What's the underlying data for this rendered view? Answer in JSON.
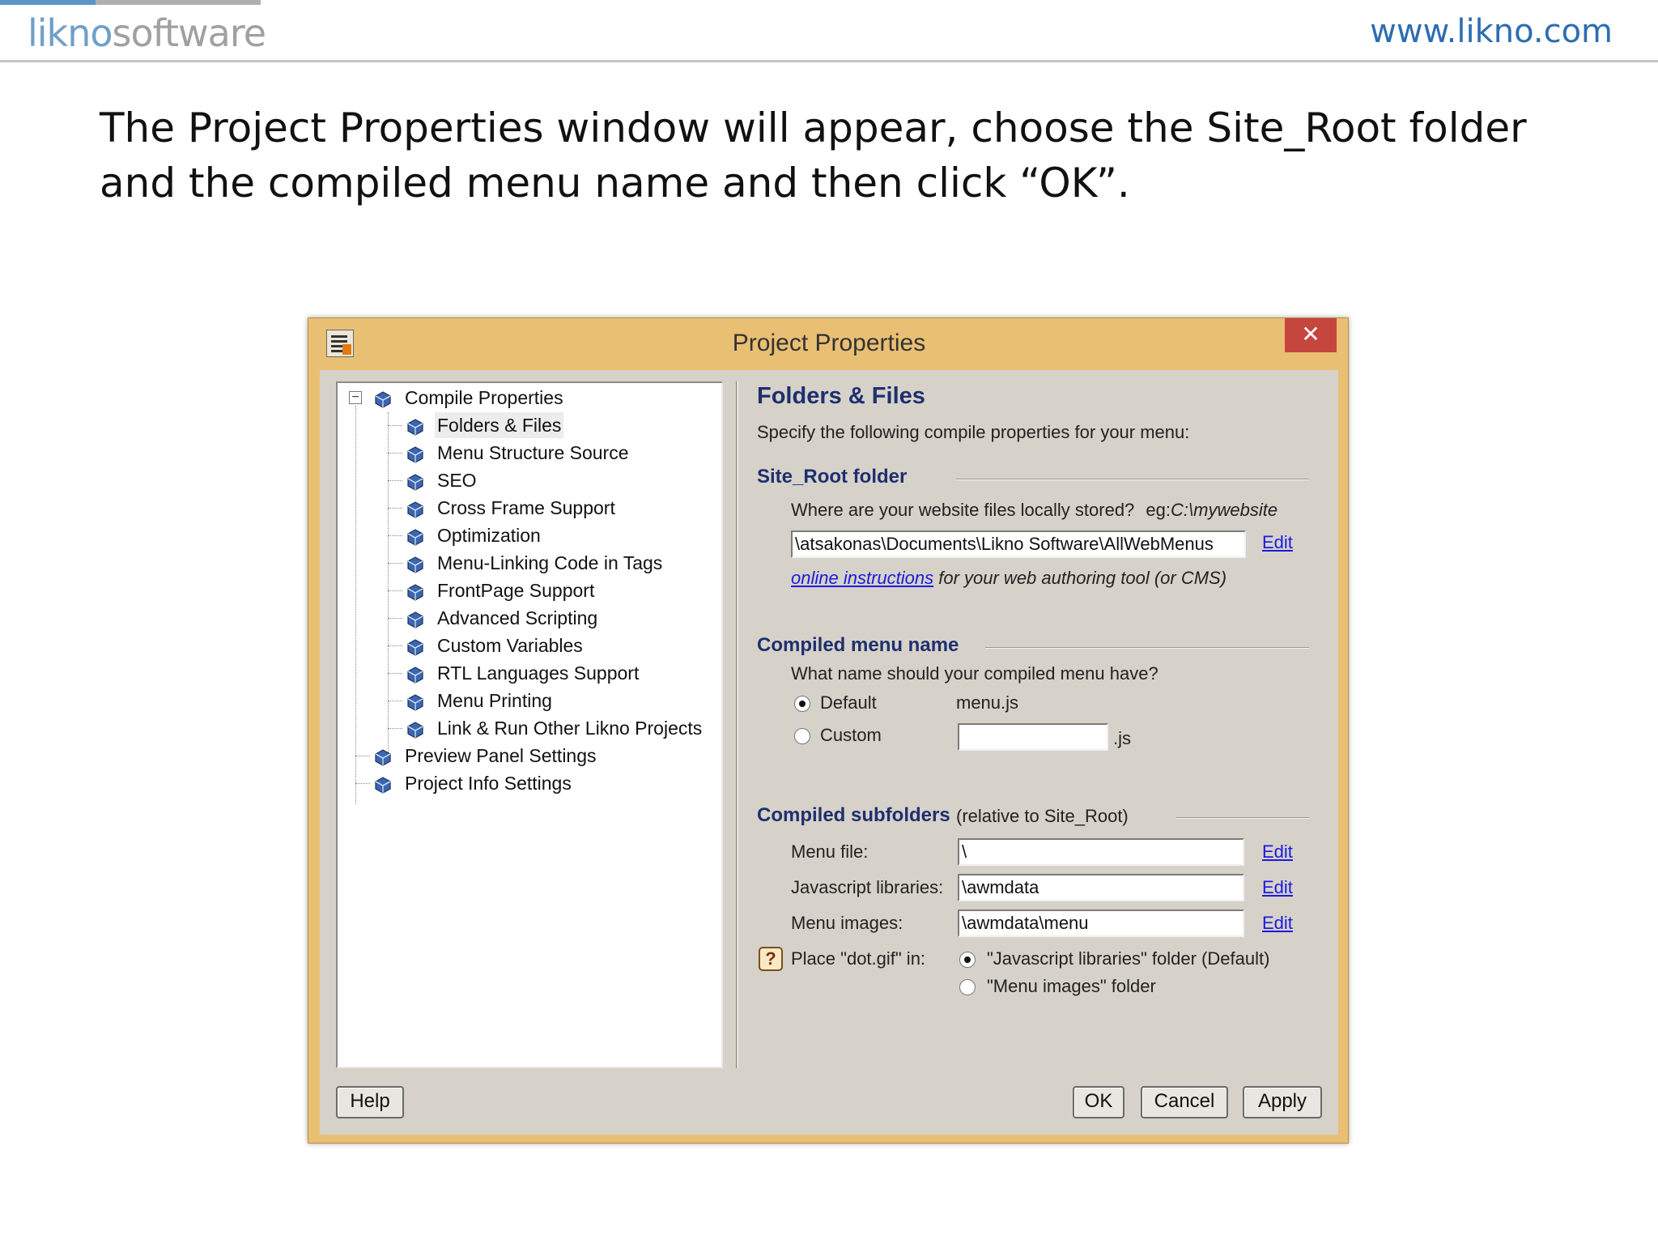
{
  "header": {
    "logo_part1": "likno",
    "logo_part2": "software",
    "website": "www.likno.com"
  },
  "instruction": "The Project Properties window will appear, choose the Site_Root folder and the compiled menu name and then click “OK”.",
  "window": {
    "title": "Project Properties",
    "close_glyph": "✕"
  },
  "tree": {
    "root": "Compile Properties",
    "children": [
      "Folders & Files",
      "Menu Structure Source",
      "SEO",
      "Cross Frame Support",
      "Optimization",
      "Menu-Linking Code in Tags",
      "FrontPage Support",
      "Advanced Scripting",
      "Custom Variables",
      "RTL Languages Support",
      "Menu Printing",
      "Link & Run Other Likno Projects"
    ],
    "other_roots": [
      "Preview Panel Settings",
      "Project Info Settings"
    ],
    "selected": "Folders & Files",
    "expander_glyph": "−"
  },
  "panel": {
    "title": "Folders & Files",
    "subtitle": "Specify the following compile properties for your menu:",
    "site_root": {
      "heading": "Site_Root folder",
      "question": "Where are your website files locally stored?",
      "example_prefix": "eg:",
      "example": "C:\\mywebsite",
      "path_value": "\\atsakonas\\Documents\\Likno Software\\AllWebMenus",
      "edit": "Edit",
      "online_link": "online instructions",
      "online_rest": "for your web authoring tool (or CMS)"
    },
    "compiled_name": {
      "heading": "Compiled menu name",
      "question": "What name should your compiled menu have?",
      "default_label": "Default",
      "default_value": "menu.js",
      "custom_label": "Custom",
      "custom_value": "",
      "custom_suffix": ".js",
      "selected": "Default"
    },
    "subfolders": {
      "heading": "Compiled subfolders",
      "note": "(relative to Site_Root)",
      "rows": [
        {
          "label": "Menu file:",
          "value": "\\",
          "edit": "Edit"
        },
        {
          "label": "Javascript libraries:",
          "value": "\\awmdata",
          "edit": "Edit"
        },
        {
          "label": "Menu images:",
          "value": "\\awmdata\\menu",
          "edit": "Edit"
        }
      ],
      "dotgif_help": "?",
      "dotgif_label": "Place \"dot.gif\" in:",
      "dotgif_option1": "\"Javascript libraries\" folder (Default)",
      "dotgif_option2": "\"Menu images\" folder",
      "dotgif_selected": "option1"
    }
  },
  "buttons": {
    "help": "Help",
    "ok": "OK",
    "cancel": "Cancel",
    "apply": "Apply"
  },
  "colors": {
    "window_frame": "#e9bf73",
    "dialog_body": "#d6d2c9",
    "heading_blue": "#1f2f6f",
    "link_blue": "#1a1ae0",
    "close_red": "#c5463f"
  }
}
